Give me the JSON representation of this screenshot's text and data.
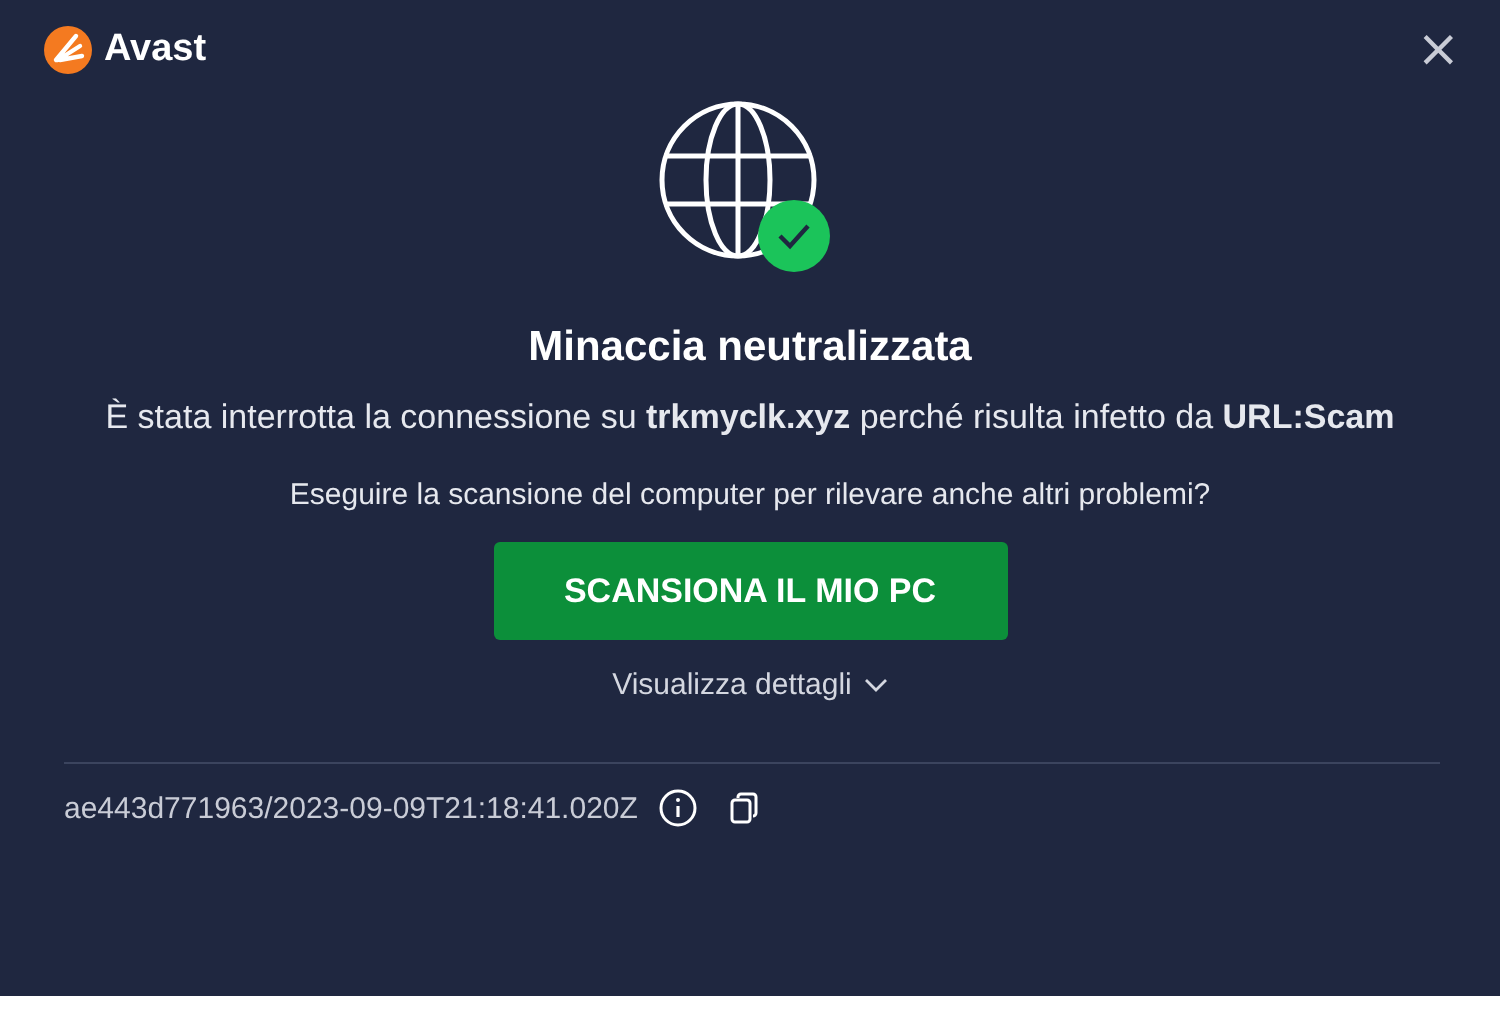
{
  "window": {
    "brand": "Avast",
    "close": "×"
  },
  "alert": {
    "title": "Minaccia neutralizzata",
    "message": "È stata interrotta la connessione su **trkmyclk.xyz** perché risulta infetto da **URL:Scam**",
    "question": "Eseguire la scansione del computer per rilevare anche altri problemi?",
    "button": "SCANSIONA IL MIO PC",
    "details_link": "Visualizza dettagli"
  },
  "footer": {
    "id": "ae443d771963/2023-09-09T21:18:41.020Z"
  }
}
